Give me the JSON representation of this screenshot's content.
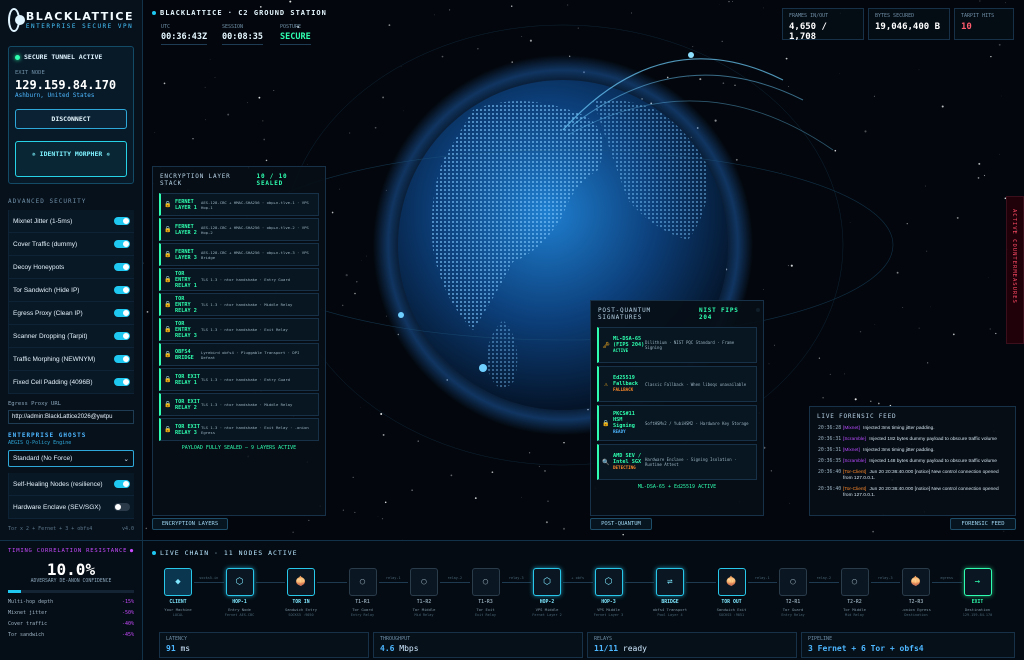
{
  "brand": {
    "name": "BLACKLATTICE",
    "tagline": "ENTERPRISE SECURE VPN"
  },
  "tunnel": {
    "status": "SECURE TUNNEL ACTIVE",
    "exit_label": "EXIT NODE",
    "ip": "129.159.84.170",
    "location": "Ashburn, United States",
    "disconnect": "DISCONNECT",
    "morph": "✵ IDENTITY MORPHER ✵"
  },
  "advanced": {
    "heading": "ADVANCED SECURITY",
    "items": [
      {
        "label": "Mixnet Jitter (1-5ms)",
        "on": true
      },
      {
        "label": "Cover Traffic (dummy)",
        "on": true
      },
      {
        "label": "Decoy Honeypots",
        "on": true
      },
      {
        "label": "Tor Sandwich (Hide IP)",
        "on": true
      },
      {
        "label": "Egress Proxy (Clean IP)",
        "on": true
      },
      {
        "label": "Scanner Dropping (Tarpit)",
        "on": true
      },
      {
        "label": "Traffic Morphing (NEWNYM)",
        "on": true
      },
      {
        "label": "Fixed Cell Padding (4096B)",
        "on": true
      }
    ]
  },
  "egress": {
    "label": "Egress Proxy URL",
    "value": "http://admin:BlackLattice2026@ywtpu"
  },
  "ghosts": {
    "heading": "ENTERPRISE GHOSTS",
    "sub": "AEGIS Q-Policy Engine",
    "select": "Standard (No Force)",
    "items": [
      {
        "label": "Self-Healing Nodes (resilience)",
        "on": true
      },
      {
        "label": "Hardware Enclave (SEV/SGX)",
        "on": false
      }
    ]
  },
  "sidebar_footer": {
    "left": "Tor x 2 + Fernet + 3 + obfs4",
    "right": "v4.0"
  },
  "timing": {
    "heading": "TIMING CORRELATION RESISTANCE",
    "value": "10.0%",
    "sub": "ADVERSARY DE-ANON CONFIDENCE",
    "fill": 0.1,
    "rows": [
      {
        "label": "Multi-hop depth",
        "value": "-15%"
      },
      {
        "label": "Mixnet jitter",
        "value": "-50%"
      },
      {
        "label": "Cover traffic",
        "value": "-40%"
      },
      {
        "label": "Tor sandwich",
        "value": "-45%"
      }
    ]
  },
  "header": {
    "title": "BLACKLATTICE · C2 GROUND STATION",
    "clocks": [
      {
        "label": "UTC",
        "value": "00:36:43Z"
      },
      {
        "label": "SESSION",
        "value": "00:08:35"
      },
      {
        "label": "POSTURE",
        "value": "SECURE"
      }
    ]
  },
  "metrics": [
    {
      "label": "FRAMES IN/OUT",
      "value": "4,650 / 1,708"
    },
    {
      "label": "BYTES SECURED",
      "value": "19,046,400 B"
    },
    {
      "label": "TARPIT HITS",
      "value": "10"
    }
  ],
  "layers": {
    "heading": "ENCRYPTION LAYER STACK",
    "count": "10 / 10 SEALED",
    "footer": "PAYLOAD FULLY SEALED — 9 LAYERS ACTIVE",
    "tab": "ENCRYPTION LAYERS",
    "items": [
      {
        "name": "FERNET LAYER 1",
        "desc": "AES-128-CBC + HMAC-SHA256 · obp+n-tlve-1 · VPS Hop-1"
      },
      {
        "name": "FERNET LAYER 2",
        "desc": "AES-128-CBC + HMAC-SHA256 · obp+n-tlve-2 · VPS Hop-2"
      },
      {
        "name": "FERNET LAYER 3",
        "desc": "AES-128-CBC + HMAC-SHA256 · obp+n-tlve-3 · VPS Bridge"
      },
      {
        "name": "TOR ENTRY RELAY 1",
        "desc": "TLS 1.3 · ntor handshake · Entry Guard"
      },
      {
        "name": "TOR ENTRY RELAY 2",
        "desc": "TLS 1.3 · ntor handshake · Middle Relay"
      },
      {
        "name": "TOR ENTRY RELAY 3",
        "desc": "TLS 1.3 · ntor handshake · Exit Relay"
      },
      {
        "name": "OBFS4 BRIDGE",
        "desc": "Lyrebird obfs4 · Pluggable Transport · DPI Defeat"
      },
      {
        "name": "TOR EXIT RELAY 1",
        "desc": "TLS 1.3 · ntor handshake · Entry Guard"
      },
      {
        "name": "TOR EXIT RELAY 2",
        "desc": "TLS 1.3 · ntor handshake · Middle Relay"
      },
      {
        "name": "TOR EXIT RELAY 3",
        "desc": "TLS 1.3 · ntor handshake · Exit Relay · .onion Egress"
      }
    ]
  },
  "pq": {
    "heading": "POST-QUANTUM SIGNATURES",
    "badge": "NIST FIPS 204",
    "footer": "ML-DSA-65 + Ed25519 ACTIVE",
    "tab": "POST-QUANTUM",
    "items": [
      {
        "icon": "🗝",
        "name": "ML-DSA-65 (FIPS 204)",
        "desc": "Dilithium · NIST PQC Standard · Frame Signing",
        "status": "ACTIVE",
        "cls": ""
      },
      {
        "icon": "⚠",
        "name": "Ed25519 Fallback",
        "desc": "Classic Fallback · When liboqs unavailable",
        "status": "FALLBACK",
        "cls": "w"
      },
      {
        "icon": "🔒",
        "name": "PKCS#11 HSM Signing",
        "desc": "SoftHSMv2 / YubiHSM2 · Hardware Key Storage",
        "status": "READY",
        "cls": "c"
      },
      {
        "icon": "🔍",
        "name": "AMD SEV / Intel SGX",
        "desc": "Hardware Enclave · Signing Isolation · Runtime Attest",
        "status": "DETECTING",
        "cls": "w"
      }
    ]
  },
  "feed": {
    "heading": "LIVE FORENSIC FEED",
    "tab": "FORENSIC FEED",
    "items": [
      {
        "t": "20:36:28",
        "src": "[Mixnet]",
        "cls": "",
        "msg": "Injected 3ms timing jitter padding."
      },
      {
        "t": "20:36:31",
        "src": "[Scramble]",
        "cls": "",
        "msg": "Injected 182 bytes dummy payload to obscure traffic volume"
      },
      {
        "t": "20:36:31",
        "src": "[Mixnet]",
        "cls": "",
        "msg": "Injected 3ms timing jitter padding."
      },
      {
        "t": "20:36:35",
        "src": "[Scramble]",
        "cls": "",
        "msg": "Injected 148 bytes dummy payload to obscure traffic volume"
      },
      {
        "t": "20:36:40",
        "src": "[Tor-Client]",
        "cls": "o",
        "msg": "Jun 20 20:36:40.000 [notice] New control connection opened from 127.0.0.1."
      },
      {
        "t": "20:36:40",
        "src": "[Tor-Client]",
        "cls": "o",
        "msg": "Jun 20 20:36:40.000 [notice] New control connection opened from 127.0.0.1."
      }
    ]
  },
  "countermeasures": "ACTIVE COUNTERMEASURES",
  "chain": {
    "heading": "LIVE CHAIN · 11 NODES ACTIVE",
    "nodes": [
      {
        "glyph": "◆",
        "title": "CLIENT",
        "sub": "Your Machine",
        "sub2": "LOCAL",
        "cls": "client",
        "lc": ""
      },
      {
        "glyph": "⬡",
        "title": "HOP-1",
        "sub": "Entry Node",
        "sub2": "Fernet AES-CBC",
        "cls": "hi",
        "lc": ""
      },
      {
        "glyph": "🧅",
        "title": "TOR IN",
        "sub": "Sandwich Entry",
        "sub2": "SOCKS5 :9050",
        "cls": "tor",
        "lc": ""
      },
      {
        "glyph": "○",
        "title": "T1-R1",
        "sub": "Tor Guard",
        "sub2": "Entry Relay",
        "cls": "",
        "lc": "g"
      },
      {
        "glyph": "○",
        "title": "T1-R2",
        "sub": "Tor Middle",
        "sub2": "Mid Relay",
        "cls": "",
        "lc": "g"
      },
      {
        "glyph": "○",
        "title": "T1-R3",
        "sub": "Tor Exit",
        "sub2": "Exit Relay",
        "cls": "",
        "lc": "g"
      },
      {
        "glyph": "⬡",
        "title": "HOP-2",
        "sub": "VPS Middle",
        "sub2": "Fernet Layer 2",
        "cls": "hi",
        "lc": ""
      },
      {
        "glyph": "⬡",
        "title": "HOP-3",
        "sub": "VPS Middle",
        "sub2": "Fernet Layer 3",
        "cls": "hi",
        "lc": ""
      },
      {
        "glyph": "⇌",
        "title": "BRIDGE",
        "sub": "obfs4 Transport",
        "sub2": "Pool Layer 4",
        "cls": "hi",
        "lc": ""
      },
      {
        "glyph": "🧅",
        "title": "TOR OUT",
        "sub": "Sandwich Exit",
        "sub2": "SOCKS5 :9051",
        "cls": "tor",
        "lc": ""
      },
      {
        "glyph": "○",
        "title": "T2-R1",
        "sub": "Tor Guard",
        "sub2": "Entry Relay",
        "cls": "",
        "lc": "g"
      },
      {
        "glyph": "○",
        "title": "T2-R2",
        "sub": "Tor Middle",
        "sub2": "Mid Relay",
        "cls": "",
        "lc": "g"
      },
      {
        "glyph": "🧅",
        "title": "T2-R3",
        "sub": ".onion Egress",
        "sub2": "Destination",
        "cls": "",
        "lc": "g"
      },
      {
        "glyph": "→",
        "title": "EXIT",
        "sub": "Destination",
        "sub2": "129.159.84.170",
        "cls": "exit",
        "lc": "e"
      }
    ],
    "links": [
      "socks5-in",
      "",
      "",
      "relay-1",
      "relay-2",
      "relay-3",
      "+ obfs",
      "",
      "",
      "relay-1",
      "relay-2",
      "relay-3",
      "egress"
    ]
  },
  "stats": [
    {
      "label": "LATENCY",
      "value": "91",
      "unit": " ms"
    },
    {
      "label": "THROUGHPUT",
      "value": "4.6",
      "unit": " Mbps"
    },
    {
      "label": "RELAYS",
      "value": "11/11",
      "unit": " ready"
    },
    {
      "label": "PIPELINE",
      "value": "3 Fernet + 6 Tor + obfs4",
      "unit": ""
    }
  ]
}
